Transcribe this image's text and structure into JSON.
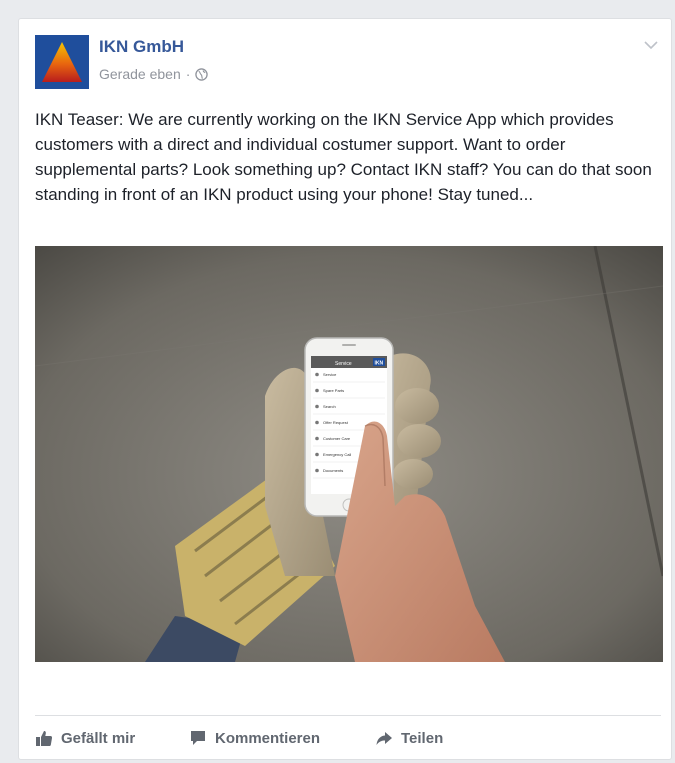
{
  "post": {
    "author": "IKN GmbH",
    "timestamp": "Gerade eben",
    "separator": "·",
    "audience_icon": "globe-icon",
    "text": "IKN Teaser: We are currently working on the IKN Service App which provides customers with a direct and individual costumer support. Want to order supplemental parts? Look something up? Contact IKN staff? You can do that soon standing in front of an IKN product using your phone! Stay tuned..."
  },
  "phone_screen": {
    "title": "Service",
    "brand": "IKN",
    "menu": [
      "Service",
      "Spare Parts",
      "Search",
      "Offer Request",
      "Customer Care",
      "Emergency Call",
      "Documents"
    ]
  },
  "actions": {
    "like": "Gefällt mir",
    "comment": "Kommentieren",
    "share": "Teilen"
  },
  "colors": {
    "author_link": "#365899",
    "meta": "#90949c",
    "action": "#616770",
    "logo_blue": "#1f4e9c",
    "logo_yellow": "#f6c400",
    "logo_red": "#c0281d"
  }
}
